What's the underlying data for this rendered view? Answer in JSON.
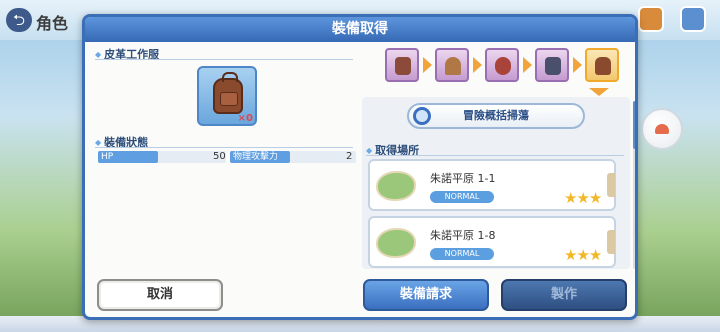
{
  "background": {
    "screen_title": "角色"
  },
  "dialog": {
    "title": "裝備取得",
    "item_name": "皮革工作服",
    "item_count": "×0",
    "status_section": "裝備狀態",
    "stats": [
      {
        "label": "HP",
        "value": "50"
      },
      {
        "label": "物理攻擊力",
        "value": "2"
      }
    ],
    "sweep_button": "冒險概括掃蕩",
    "source_section": "取得場所",
    "locations": [
      {
        "name": "朱諾平原 1-1",
        "difficulty": "NORMAL",
        "stars": "★★★"
      },
      {
        "name": "朱諾平原 1-8",
        "difficulty": "NORMAL",
        "stars": "★★★"
      }
    ],
    "buttons": {
      "cancel": "取消",
      "request": "裝備請求",
      "craft": "製作"
    }
  },
  "colors": {
    "accent": "#3a6fb8",
    "star": "#f3b828",
    "arrow": "#f2a33a"
  }
}
